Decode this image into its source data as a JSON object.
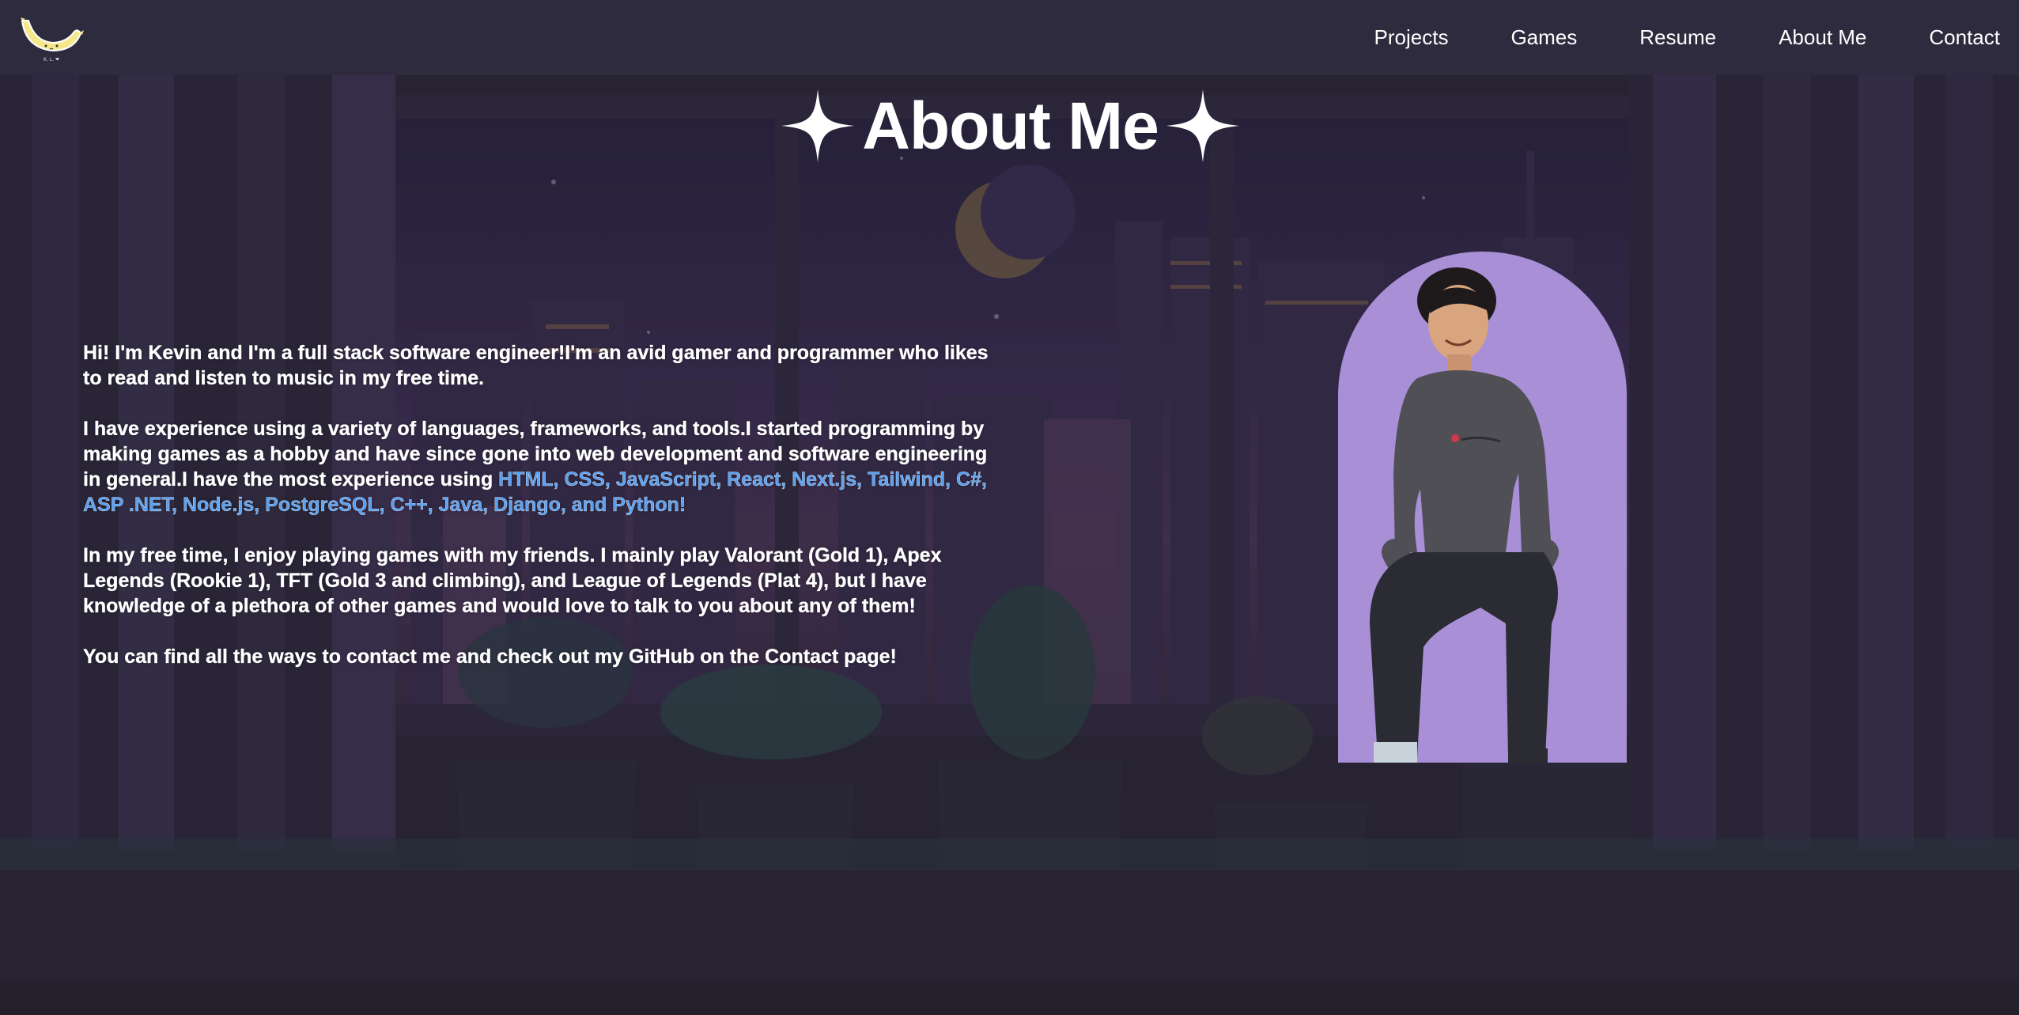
{
  "nav": {
    "logo_icon": "banana-logo-icon",
    "links": [
      "Projects",
      "Games",
      "Resume",
      "About Me",
      "Contact"
    ]
  },
  "main": {
    "title": "About Me",
    "sparkle_icon": "four-point-star-icon",
    "paragraphs": {
      "intro": "Hi! I'm Kevin and I'm a full stack software engineer!I'm an avid gamer and programmer who likes to read and listen to music in my free time.",
      "experience_lead": "I have experience using a variety of languages, frameworks, and tools.I started programming by making games as a hobby and have since gone into web development and software engineering in general.I have the most experience using ",
      "tech_list": "HTML, CSS, JavaScript, React, Next.js, Tailwind, C#, ASP .NET, Node.js, PostgreSQL, C++, Java, Django, and Python!",
      "games": "In my free time, I enjoy playing games with my friends. I mainly play Valorant (Gold 1), Apex Legends (Rookie 1), TFT (Gold 3 and climbing), and League of Legends (Plat 4), but I have knowledge of a plethora of other games and would love to talk to you about any of them!",
      "contact": "You can find all the ways to contact me and check out my GitHub on the Contact page!"
    },
    "portrait_icon": "person-portrait-photo"
  },
  "colors": {
    "background": "#2b2738",
    "navbar": "#2f2b3f",
    "text": "#ffffff",
    "accent_link": "#5aa0f2",
    "portrait_bg": "#a98fd6"
  }
}
